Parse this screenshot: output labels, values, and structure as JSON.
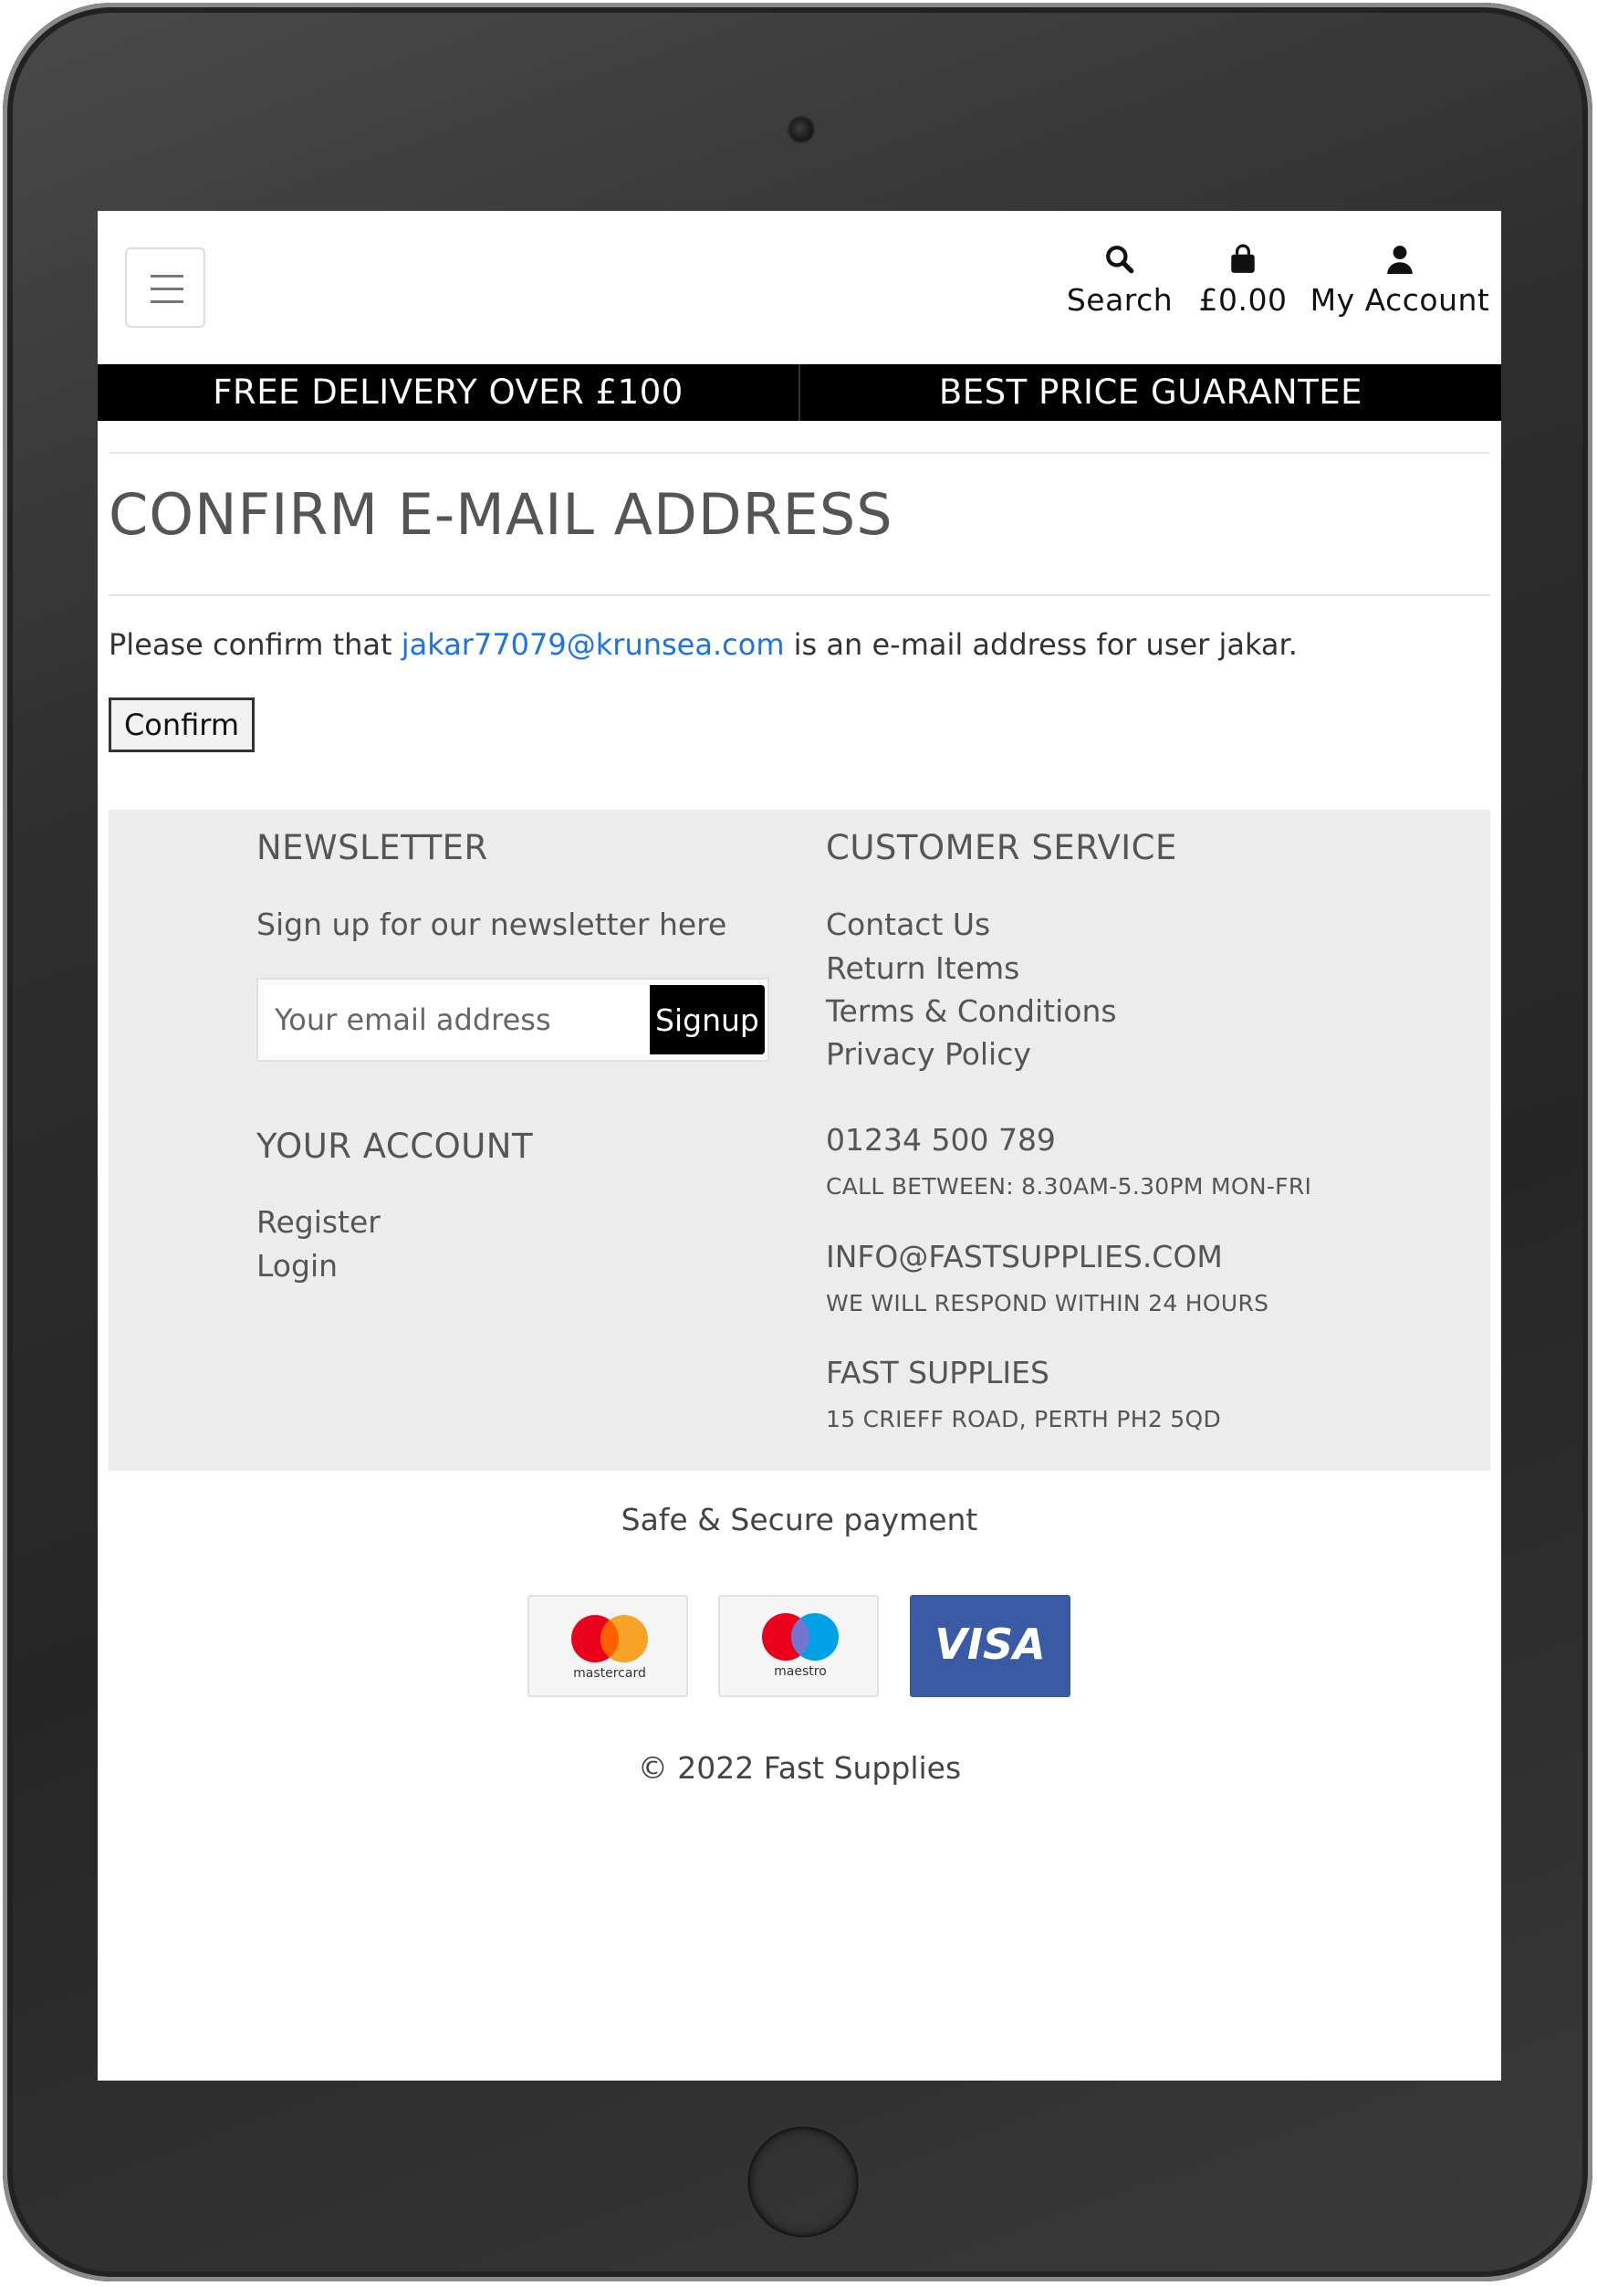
{
  "header": {
    "nav": {
      "search_label": "Search",
      "cart_label": "£0.00",
      "account_label": "My Account"
    },
    "promos": [
      "FREE DELIVERY OVER £100",
      "BEST PRICE GUARANTEE"
    ]
  },
  "main": {
    "title": "CONFIRM E-MAIL ADDRESS",
    "message_prefix": "Please confirm that",
    "email": "jakar77079@krunsea.com",
    "message_suffix": "is an e-mail address for user jakar.",
    "confirm_label": "Confirm"
  },
  "footer": {
    "newsletter": {
      "heading": "NEWSLETTER",
      "text": "Sign up for our newsletter here",
      "placeholder": "Your email address",
      "signup_label": "Signup"
    },
    "account": {
      "heading": "YOUR ACCOUNT",
      "links": [
        "Register",
        "Login"
      ]
    },
    "customer_service": {
      "heading": "CUSTOMER SERVICE",
      "links": [
        "Contact Us",
        "Return Items",
        "Terms & Conditions",
        "Privacy Policy"
      ],
      "phone": "01234 500 789",
      "phone_note": "CALL BETWEEN: 8.30AM-5.30PM MON-FRI",
      "email": "INFO@FASTSUPPLIES.COM",
      "email_note": "WE WILL RESPOND WITHIN 24 HOURS",
      "company": "FAST SUPPLIES",
      "address": "15 CRIEFF ROAD, PERTH PH2 5QD"
    },
    "secure_text": "Safe & Secure payment",
    "cards": {
      "mastercard": "mastercard",
      "maestro": "maestro",
      "visa": "VISA"
    },
    "copyright": "© 2022 Fast Supplies"
  },
  "icons": {
    "search": "search-icon",
    "cart": "shopping-bag-icon",
    "account": "user-icon",
    "menu": "hamburger-menu-icon"
  },
  "colors": {
    "link": "#1a73e8",
    "promo_bar": "#000000",
    "footer_bg": "#ececec",
    "visa_blue": "#3b5aa6"
  }
}
